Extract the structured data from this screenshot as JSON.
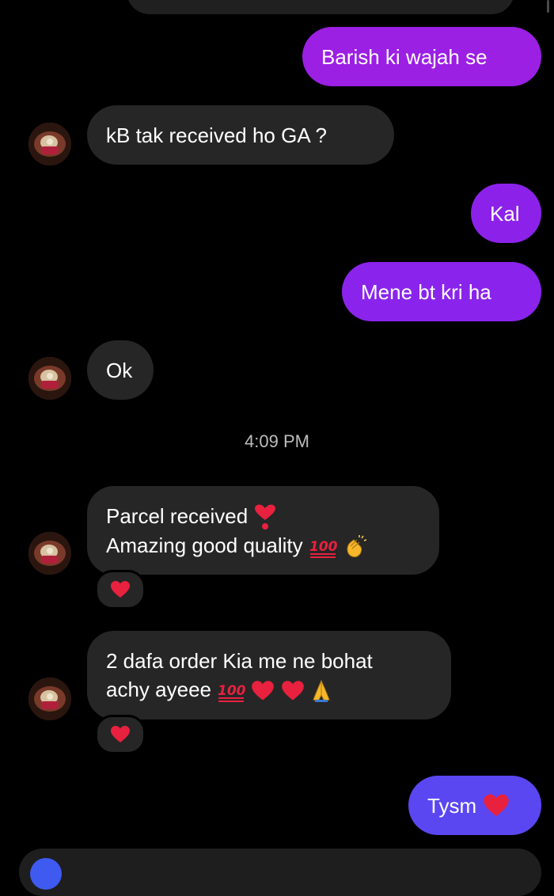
{
  "colors": {
    "background": "#000000",
    "received_bubble": "#262626",
    "sent_gradient_top": "#a21fe6",
    "sent_gradient_mid": "#8a2bee",
    "sent_gradient_bottom": "#5b47f2",
    "heart": "#e8213f",
    "timestamp": "#bdbdbd",
    "composer_icon": "#3e5af0"
  },
  "messages": [
    {
      "direction": "sent",
      "text": "Barish ki wajah se"
    },
    {
      "direction": "received",
      "text": "kB tak received ho GA ?"
    },
    {
      "direction": "sent",
      "text": "Kal"
    },
    {
      "direction": "sent",
      "text": "Mene bt kri ha"
    },
    {
      "direction": "received",
      "text": "Ok"
    },
    {
      "direction": "received",
      "lines": [
        "Parcel received",
        "Amazing good quality"
      ],
      "emojis": [
        "heavy-heart-exclamation",
        "hundred-points",
        "clapping-hands"
      ],
      "reaction": "red-heart"
    },
    {
      "direction": "received",
      "lines": [
        "2 dafa order Kia me ne bohat",
        "achy ayeee"
      ],
      "emojis": [
        "hundred-points",
        "red-heart",
        "red-heart",
        "folded-hands"
      ],
      "reaction": "red-heart"
    },
    {
      "direction": "sent",
      "text": "Tysm",
      "emojis": [
        "red-heart"
      ]
    }
  ],
  "timestamp": "4:09 PM",
  "icons": {
    "avatar": "contact-avatar-photo",
    "reaction": "red-heart-icon",
    "composer": "camera-icon"
  }
}
